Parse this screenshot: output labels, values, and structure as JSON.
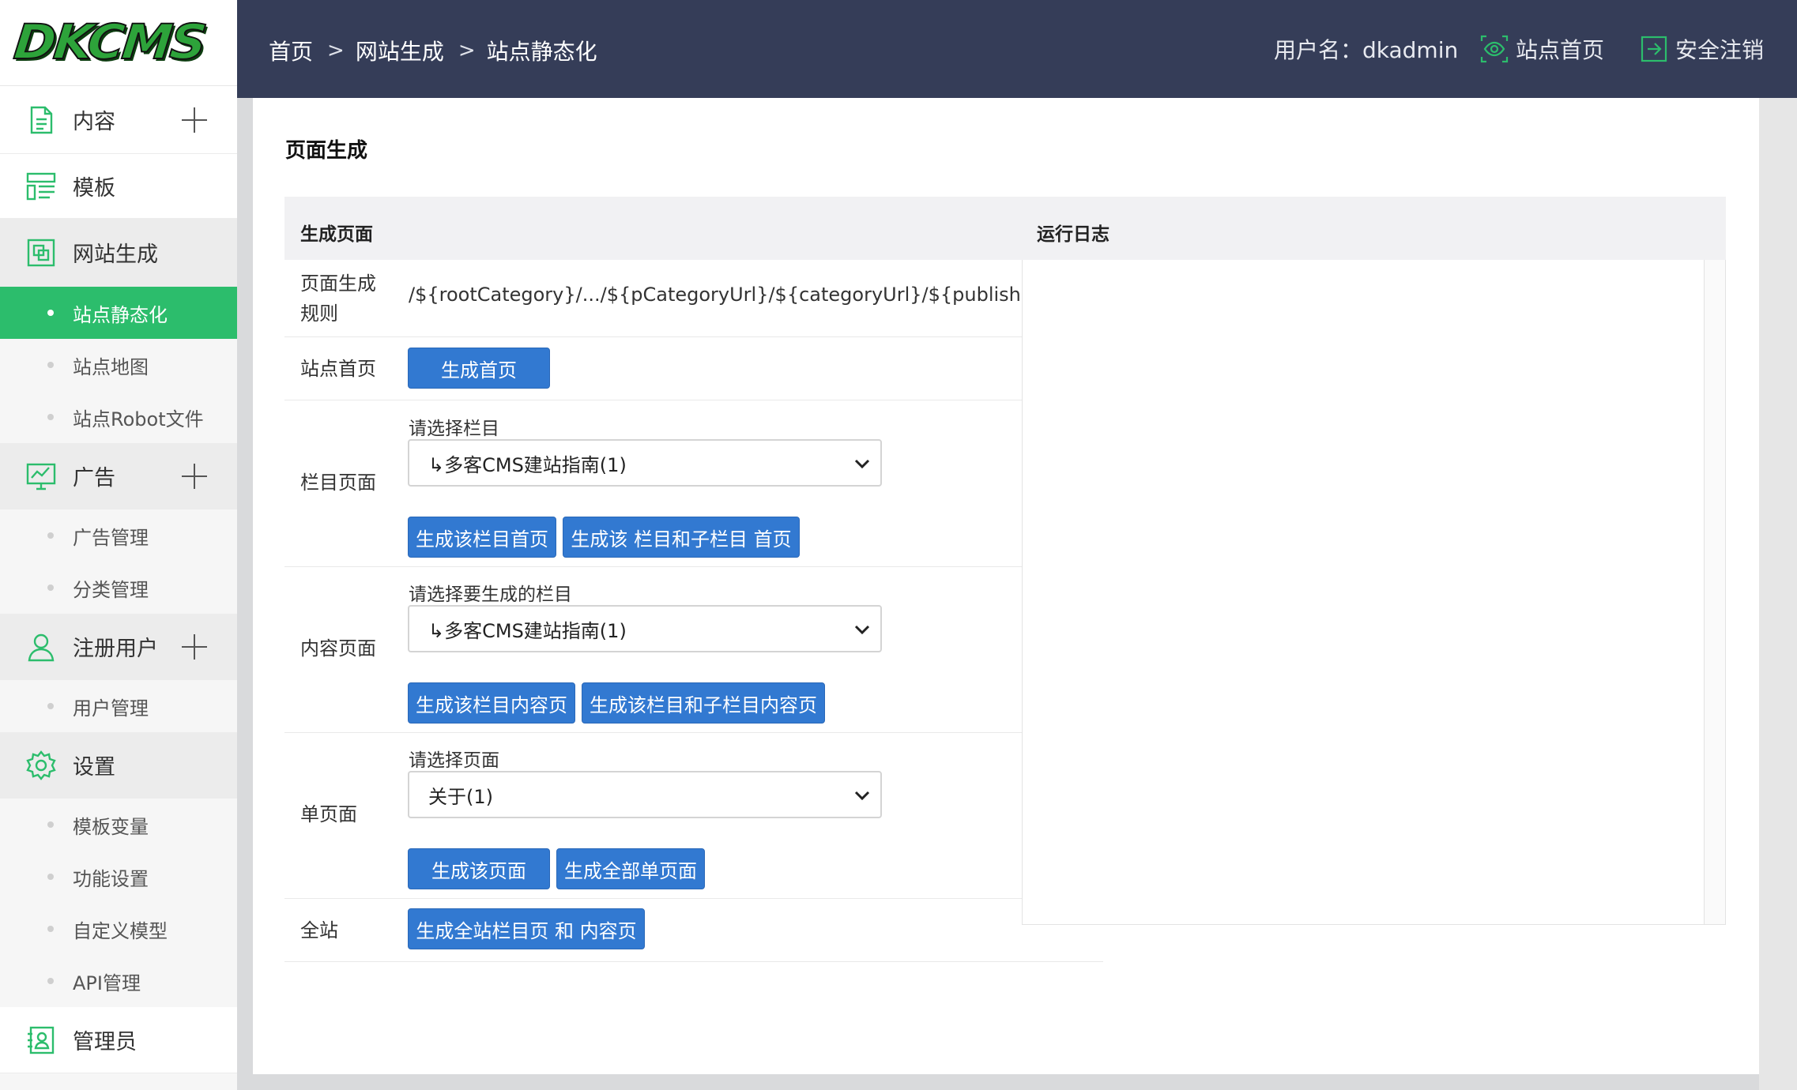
{
  "logo": "DKCMS",
  "sidebar": {
    "menus": [
      {
        "label": "内容",
        "icon": "document-icon",
        "has_plus": true
      },
      {
        "label": "模板",
        "icon": "template-icon",
        "has_plus": false
      },
      {
        "label": "网站生成",
        "icon": "layers-icon",
        "has_plus": false
      },
      {
        "label": "广告",
        "icon": "chart-monitor-icon",
        "has_plus": true
      },
      {
        "label": "注册用户",
        "icon": "user-icon",
        "has_plus": true
      },
      {
        "label": "设置",
        "icon": "gear-icon",
        "has_plus": false
      },
      {
        "label": "管理员",
        "icon": "id-card-icon",
        "has_plus": false
      }
    ],
    "subs": [
      {
        "label": "站点静态化",
        "active": true
      },
      {
        "label": "站点地图"
      },
      {
        "label": "站点Robot文件"
      },
      {
        "label": "广告管理"
      },
      {
        "label": "分类管理"
      },
      {
        "label": "用户管理"
      },
      {
        "label": "模板变量"
      },
      {
        "label": "功能设置"
      },
      {
        "label": "自定义模型"
      },
      {
        "label": "API管理"
      }
    ]
  },
  "header": {
    "breadcrumb": [
      "首页",
      "网站生成",
      "站点静态化"
    ],
    "separator": ">",
    "username_label": "用户名：dkadmin",
    "site_home": "站点首页",
    "logout": "安全注销"
  },
  "main": {
    "title": "页面生成",
    "col_generate": "生成页面",
    "col_log": "运行日志",
    "rule_label": "页面生成规则",
    "rule_value": "/${rootCategory}/.../${pCategoryUrl}/${categoryUrl}/${publishDate}${pageUrl}",
    "home_label": "站点首页",
    "home_button": "生成首页",
    "category_label": "栏目页面",
    "category_select_label": "请选择栏目",
    "category_select_value": "↳多客CMS建站指南(1)",
    "category_btn1": "生成该栏目首页",
    "category_btn2": "生成该 栏目和子栏目 首页",
    "content_label": "内容页面",
    "content_select_label": "请选择要生成的栏目",
    "content_select_value": "↳多客CMS建站指南(1)",
    "content_btn1": "生成该栏目内容页",
    "content_btn2": "生成该栏目和子栏目内容页",
    "single_label": "单页面",
    "single_select_label": "请选择页面",
    "single_select_value": "关于(1)",
    "single_btn1": "生成该页面",
    "single_btn2": "生成全部单页面",
    "all_label": "全站",
    "all_button": "生成全站栏目页 和 内容页"
  },
  "colors": {
    "accent_green": "#2cbd6c",
    "header_bg": "#353d58",
    "button_blue": "#3279d1"
  }
}
